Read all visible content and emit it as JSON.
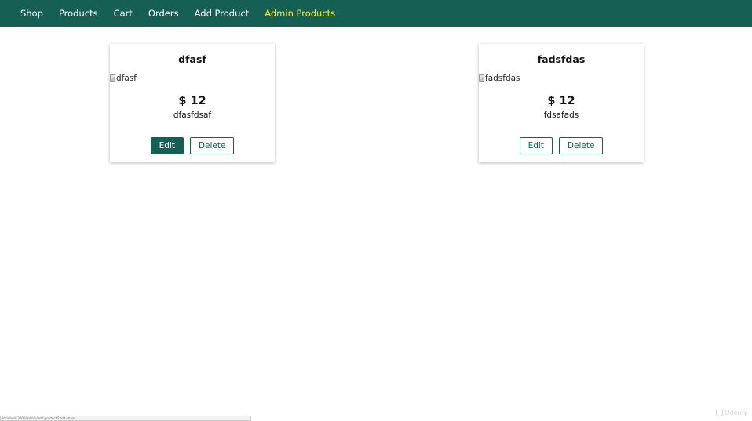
{
  "nav": {
    "items": [
      {
        "label": "Shop"
      },
      {
        "label": "Products"
      },
      {
        "label": "Cart"
      },
      {
        "label": "Orders"
      },
      {
        "label": "Add Product"
      },
      {
        "label": "Admin Products"
      }
    ],
    "active_index": 5
  },
  "products": [
    {
      "title": "dfasf",
      "image_alt": "dfasf",
      "price": "$ 12",
      "description": "dfasfdsaf",
      "edit_label": "Edit",
      "delete_label": "Delete"
    },
    {
      "title": "fadsfdas",
      "image_alt": "fadsfdas",
      "price": "$ 12",
      "description": "fdsafads",
      "edit_label": "Edit",
      "delete_label": "Delete"
    }
  ],
  "status_bar": {
    "url": "localhost:3000/admin/edit-product/?edit=true"
  },
  "watermark": {
    "text": "Udemy"
  },
  "colors": {
    "primary": "#165f55",
    "active_nav": "#f4ee3a"
  }
}
